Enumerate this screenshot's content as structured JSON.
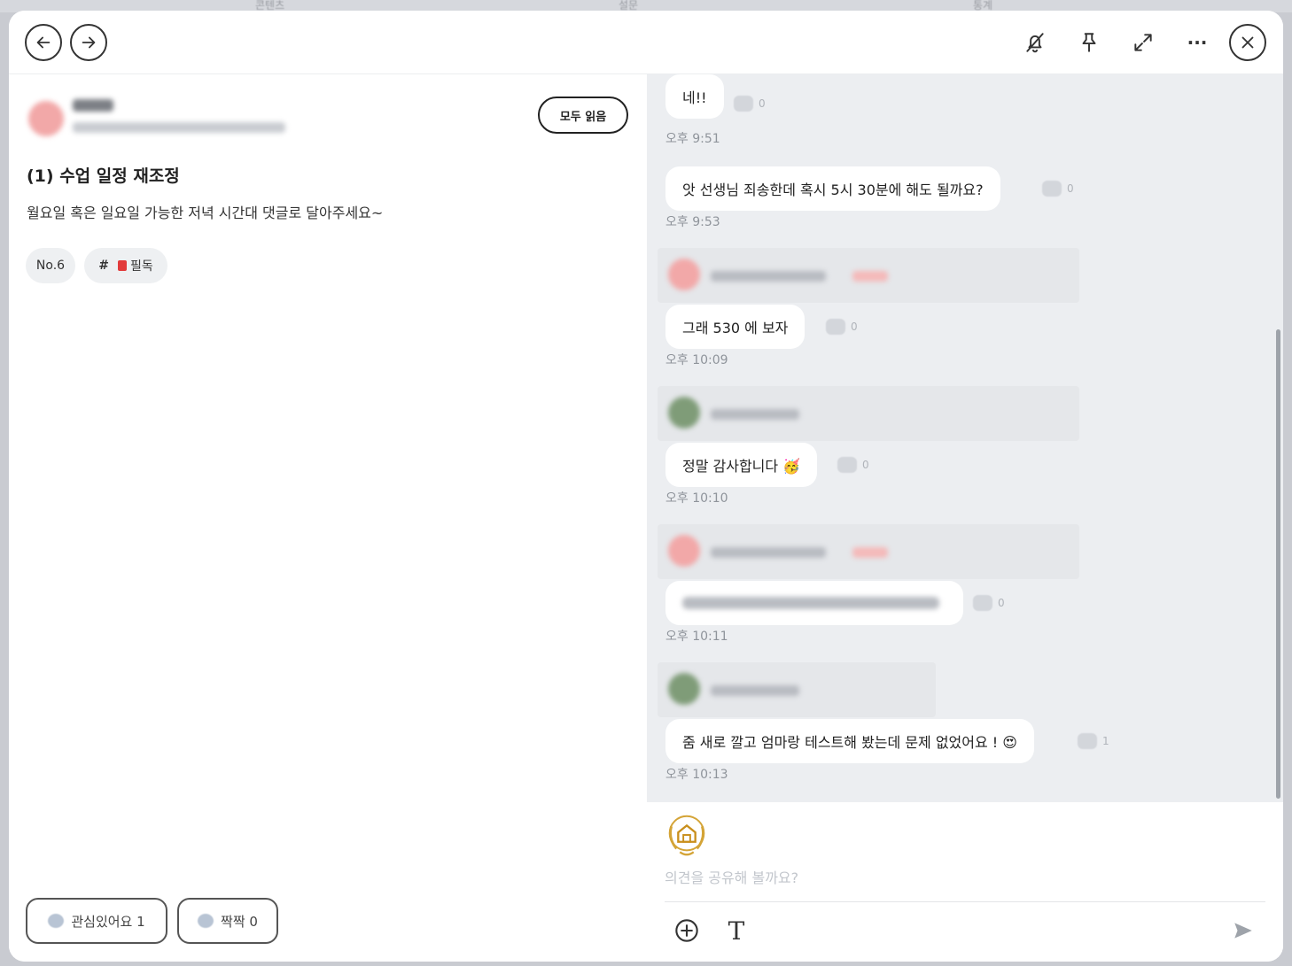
{
  "background": {
    "tabs": [
      "콘텐츠",
      "설문",
      "통계"
    ]
  },
  "topbar": {
    "back_icon": "arrow-left-icon",
    "forward_icon": "arrow-right-icon",
    "mute_icon": "bell-off-icon",
    "pin_icon": "pin-icon",
    "expand_icon": "expand-icon",
    "more_label": "···",
    "close_icon": "close-icon"
  },
  "post": {
    "read_all_label": "모두 읽음",
    "title": "(1) 수업 일정 재조정",
    "body": "월요일 혹은 일요일 가능한 저녁 시간대 댓글로 달아주세요~",
    "number_tag": "No.6",
    "hashtag_symbol": "#",
    "hashtag_label": "필독",
    "interest_label": "관심있어요 1",
    "clap_label": "짝짝 0"
  },
  "chat": {
    "messages": [
      {
        "text": "네!!",
        "reactions": "0",
        "time": "오후 9:51"
      },
      {
        "text": "앗 선생님 죄송한데 혹시 5시 30분에 해도 될까요?",
        "reactions": "0",
        "time": "오후 9:53"
      },
      {
        "text": "그래 530 에 보자",
        "reactions": "0",
        "time": "오후 10:09"
      },
      {
        "text": "정말 감사합니다 🥳",
        "reactions": "0",
        "time": "오후 10:10"
      },
      {
        "text": "",
        "reactions": "0",
        "time": "오후 10:11"
      },
      {
        "text": "줌 새로 깔고 엄마랑 테스트해 봤는데 문제 없었어요 ! 😍",
        "reactions": "1",
        "time": "오후 10:13"
      }
    ]
  },
  "composer": {
    "placeholder": "의견을 공유해 볼까요?",
    "add_icon": "plus-circle-icon",
    "text_icon": "text-format-icon",
    "text_icon_label": "T",
    "send_icon": "send-icon"
  },
  "colors": {
    "chat_background": "#eceef1",
    "bubble": "#ffffff",
    "accent_red": "#e23b3b",
    "timestamp": "#8f949b"
  }
}
